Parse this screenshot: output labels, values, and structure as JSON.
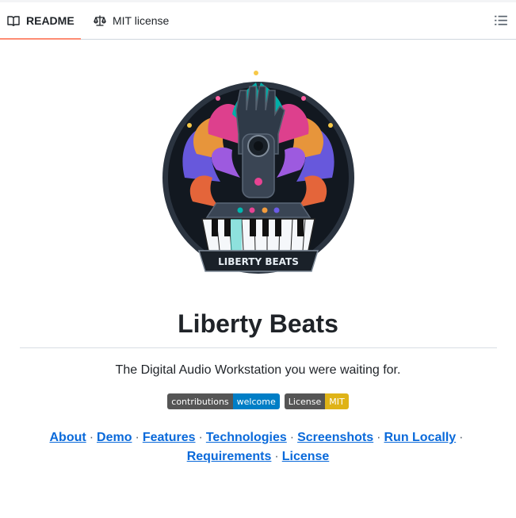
{
  "tabs": {
    "readme": "README",
    "license": "MIT license"
  },
  "header": {
    "title": "Liberty Beats",
    "tagline": "The Digital Audio Workstation you were waiting for."
  },
  "logo": {
    "text": "LIBERTY BEATS"
  },
  "badges": [
    {
      "left": "contributions",
      "right": "welcome",
      "right_color": "#007ec6"
    },
    {
      "left": "License",
      "right": "MIT",
      "right_color": "#dfb317"
    }
  ],
  "links": [
    "About",
    "Demo",
    "Features",
    "Technologies",
    "Screenshots",
    "Run Locally",
    "Requirements",
    "License"
  ],
  "separator": "·",
  "colors": {
    "accent_underline": "#fd8c73",
    "link": "#0969da"
  }
}
